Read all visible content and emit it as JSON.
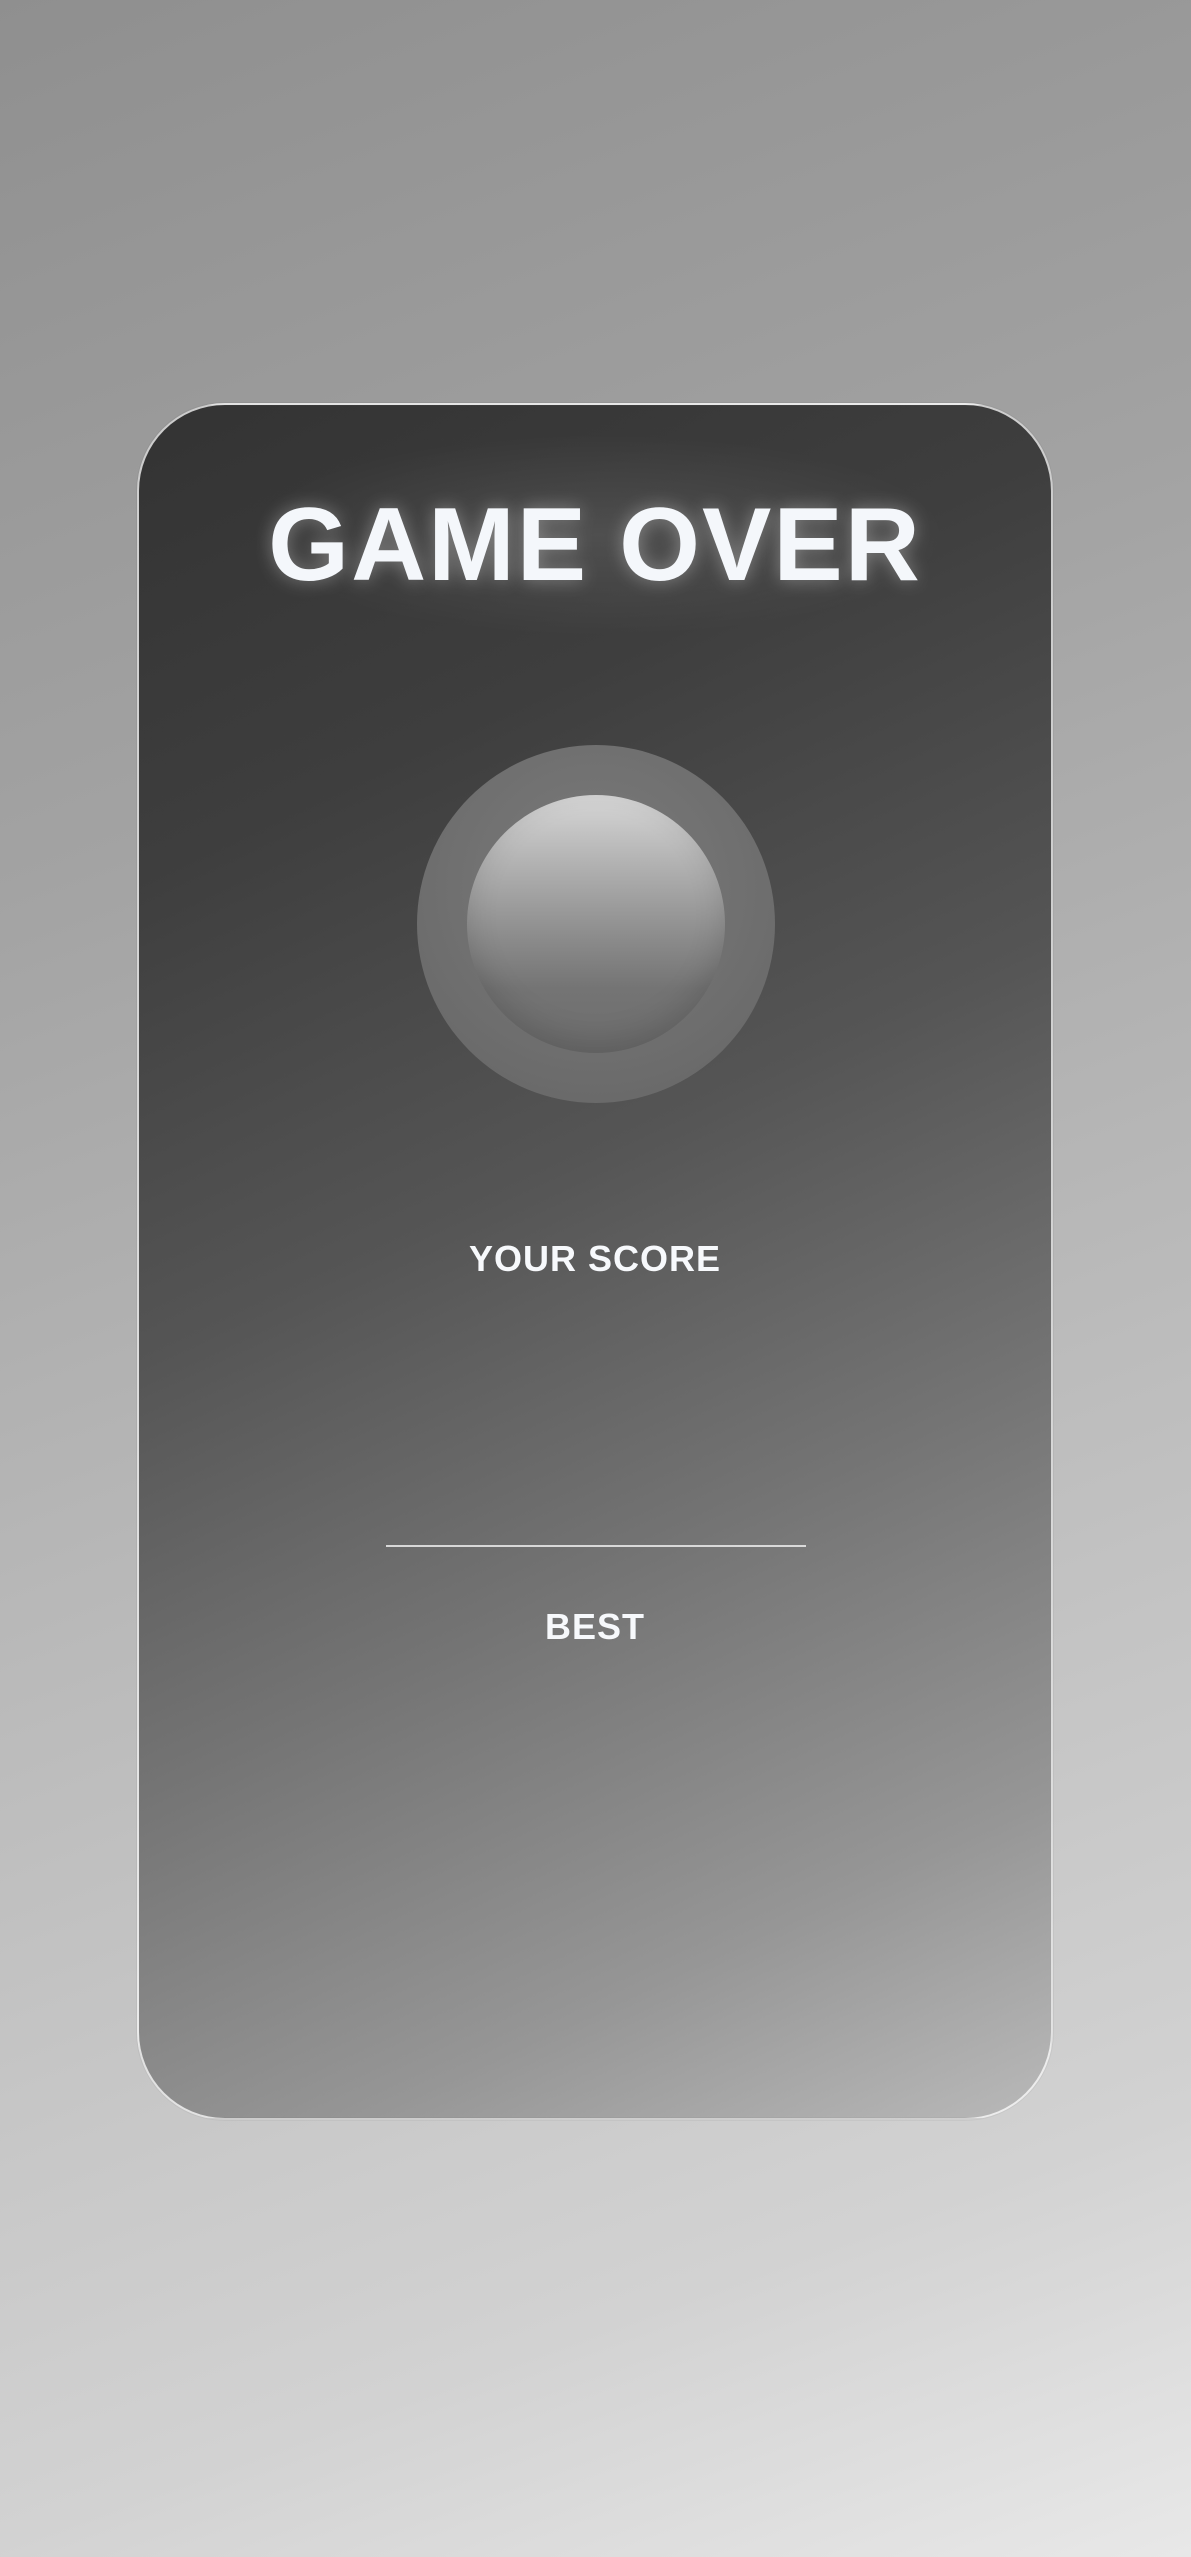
{
  "game_over": {
    "title": "GAME OVER",
    "score_label": "YOUR SCORE",
    "score_value": "",
    "best_label": "BEST",
    "best_value": ""
  },
  "colors": {
    "title_text": "#f4f7fb",
    "label_text": "#f7f9fc",
    "card_border": "#ffffff",
    "card_top": "#333333",
    "card_bottom": "#b9b9b9",
    "ball_ring": "#6e6e6e",
    "ball_highlight": "#d7d7d7"
  },
  "icons": {
    "ball": "ball-icon"
  }
}
